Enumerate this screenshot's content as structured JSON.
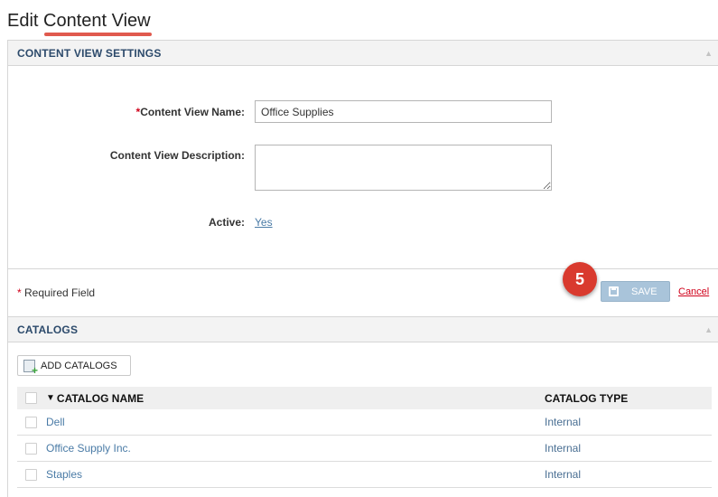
{
  "page": {
    "title_prefix": "Edit ",
    "title_underlined": "Content View"
  },
  "settings": {
    "header": "CONTENT VIEW SETTINGS",
    "name_required_mark": "*",
    "name_label": "Content View Name:",
    "name_value": "Office Supplies",
    "description_label": "Content View Description:",
    "description_value": "",
    "active_label": "Active:",
    "active_value": "Yes",
    "required_mark": "*",
    "required_note": " Required Field",
    "step_badge": "5",
    "save_label": "SAVE",
    "cancel_label": "Cancel"
  },
  "catalogs": {
    "header": "CATALOGS",
    "add_button_label": "ADD CATALOGS",
    "sort_indicator": "▼",
    "columns": {
      "name": "CATALOG NAME",
      "type": "CATALOG TYPE"
    },
    "rows": [
      {
        "name": "Dell",
        "type": "Internal"
      },
      {
        "name": "Office Supply Inc.",
        "type": "Internal"
      },
      {
        "name": "Staples",
        "type": "Internal"
      }
    ]
  },
  "colors": {
    "accent_red": "#d0021b",
    "badge_red": "#d93a2e",
    "link_blue": "#4a7ba6",
    "save_button": "#a9c4da",
    "header_text": "#2c4a6b"
  },
  "icons": {
    "collapse": "triangle-up-icon",
    "save": "floppy-disk-icon",
    "add_catalogs": "add-document-icon",
    "sort": "sort-descending-icon"
  }
}
